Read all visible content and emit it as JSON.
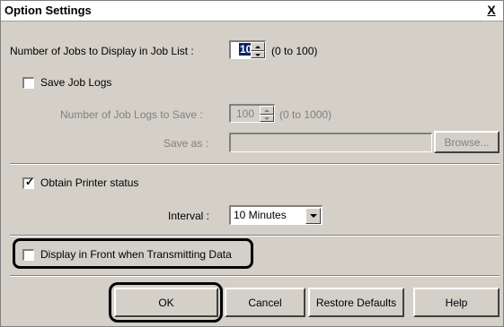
{
  "window": {
    "title": "Option Settings",
    "close_glyph": "X",
    "close_icon": "close-icon"
  },
  "jobs_display": {
    "label": "Number of Jobs to Display in Job List :",
    "value": "10",
    "range": "(0 to 100)"
  },
  "save_job_logs": {
    "label": "Save Job Logs",
    "checked": false
  },
  "job_logs_count": {
    "label": "Number of Job Logs to Save :",
    "value": "100",
    "range": "(0 to 1000)",
    "enabled": false
  },
  "save_as": {
    "label": "Save as :",
    "value": "",
    "enabled": false,
    "browse_label": "Browse..."
  },
  "obtain_status": {
    "label": "Obtain Printer status",
    "checked": true,
    "check_glyph": "✓"
  },
  "interval": {
    "label": "Interval :",
    "selected": "10 Minutes"
  },
  "display_front": {
    "label": "Display in Front when Transmitting Data",
    "checked": false
  },
  "buttons": {
    "ok": "OK",
    "cancel": "Cancel",
    "restore": "Restore Defaults",
    "help": "Help"
  },
  "colors": {
    "dialog_bg": "#d4d0c8",
    "callout": "#000000",
    "disabled_text": "#808080"
  }
}
